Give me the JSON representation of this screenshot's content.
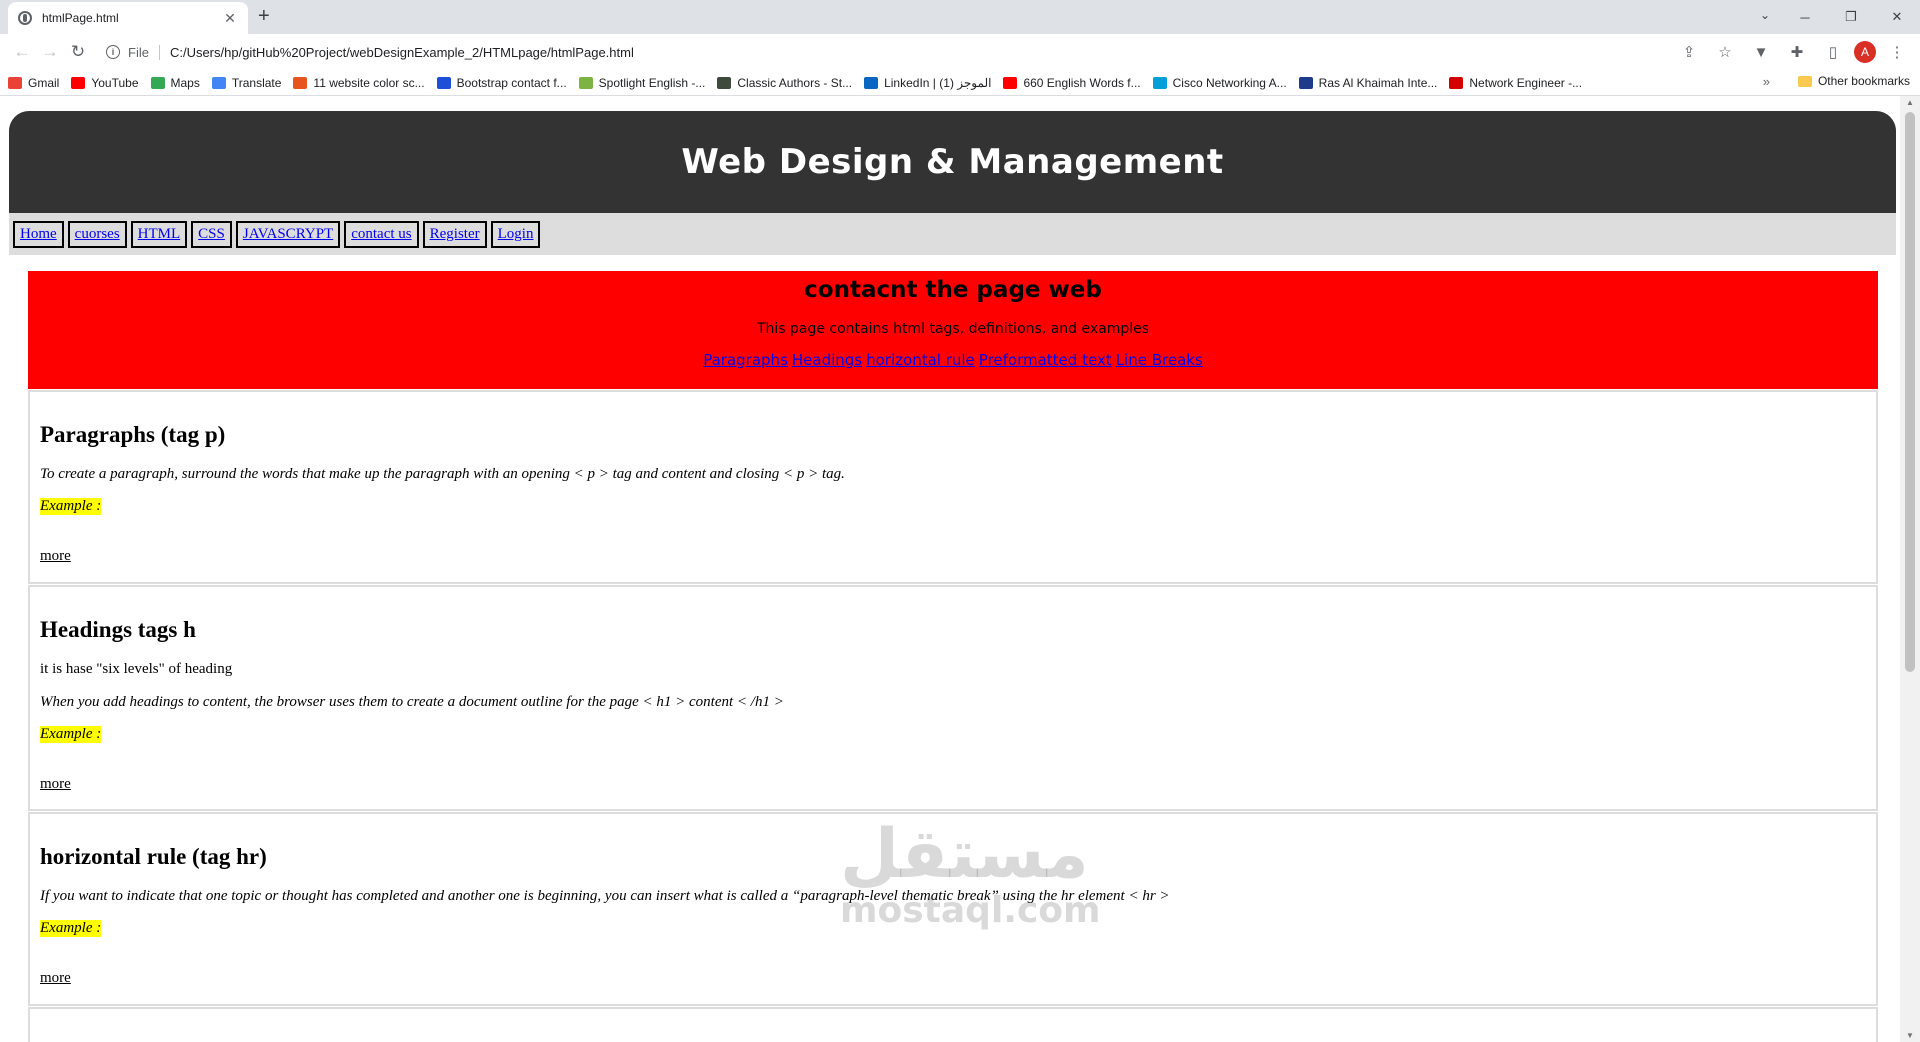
{
  "browser": {
    "tab_title": "htmlPage.html",
    "tab_close": "✕",
    "new_tab": "+",
    "scheme_label": "File",
    "url": "C:/Users/hp/gitHub%20Project/webDesignExample_2/HTMLpage/htmlPage.html",
    "profile_initial": "A",
    "bookmarks": [
      {
        "label": "Gmail",
        "color": "#ea4335"
      },
      {
        "label": "YouTube",
        "color": "#ff0000"
      },
      {
        "label": "Maps",
        "color": "#34a853"
      },
      {
        "label": "Translate",
        "color": "#4285f4"
      },
      {
        "label": "11 website color sc...",
        "color": "#e8541e"
      },
      {
        "label": "Bootstrap contact f...",
        "color": "#1d4ed8"
      },
      {
        "label": "Spotlight English -...",
        "color": "#7cb342"
      },
      {
        "label": "Classic Authors - St...",
        "color": "#3e4a3d"
      },
      {
        "label": "LinkedIn | الموجز (1)",
        "color": "#0a66c2"
      },
      {
        "label": "660 English Words f...",
        "color": "#ff0000"
      },
      {
        "label": "Cisco Networking A...",
        "color": "#049fd9"
      },
      {
        "label": "Ras Al Khaimah Inte...",
        "color": "#1e3a8a"
      },
      {
        "label": "Network Engineer -...",
        "color": "#d50000"
      }
    ],
    "bookmarks_more": "»",
    "other_bookmarks": "Other bookmarks"
  },
  "site": {
    "title": "Web Design & Management",
    "nav": [
      "Home",
      "cuorses",
      "HTML",
      "CSS",
      "JAVASCRYPT",
      "contact us",
      "Register",
      "Login"
    ],
    "hero": {
      "heading": "contacnt the page web",
      "subtitle": "This page contains html tags, definitions, and examples",
      "anchors": [
        "Paragraphs",
        "Headings",
        "horizontal rule",
        "Preformatted text",
        "Line Breaks"
      ]
    },
    "sections": {
      "paragraphs": {
        "heading": "Paragraphs (tag p)",
        "desc": "To create a paragraph, surround the words that make up the paragraph with an opening < p > tag and content and closing < p > tag.",
        "example": "Example :",
        "more": "more"
      },
      "headings": {
        "heading": "Headings tags h",
        "plain": "it is hase \"six levels\" of heading",
        "desc": "When you add headings to content, the browser uses them to create a document outline for the page < h1 > content < /h1 >",
        "example": "Example :",
        "more": "more"
      },
      "hr": {
        "heading": "horizontal rule (tag hr)",
        "desc": "If you want to indicate that one topic or thought has completed and another one is beginning, you can insert what is called a “paragraph-level thematic break” using the hr element < hr >",
        "example": "Example :",
        "more": "more"
      }
    }
  },
  "watermark": {
    "arabic": "مستقل",
    "latin": "mostaql.com"
  }
}
